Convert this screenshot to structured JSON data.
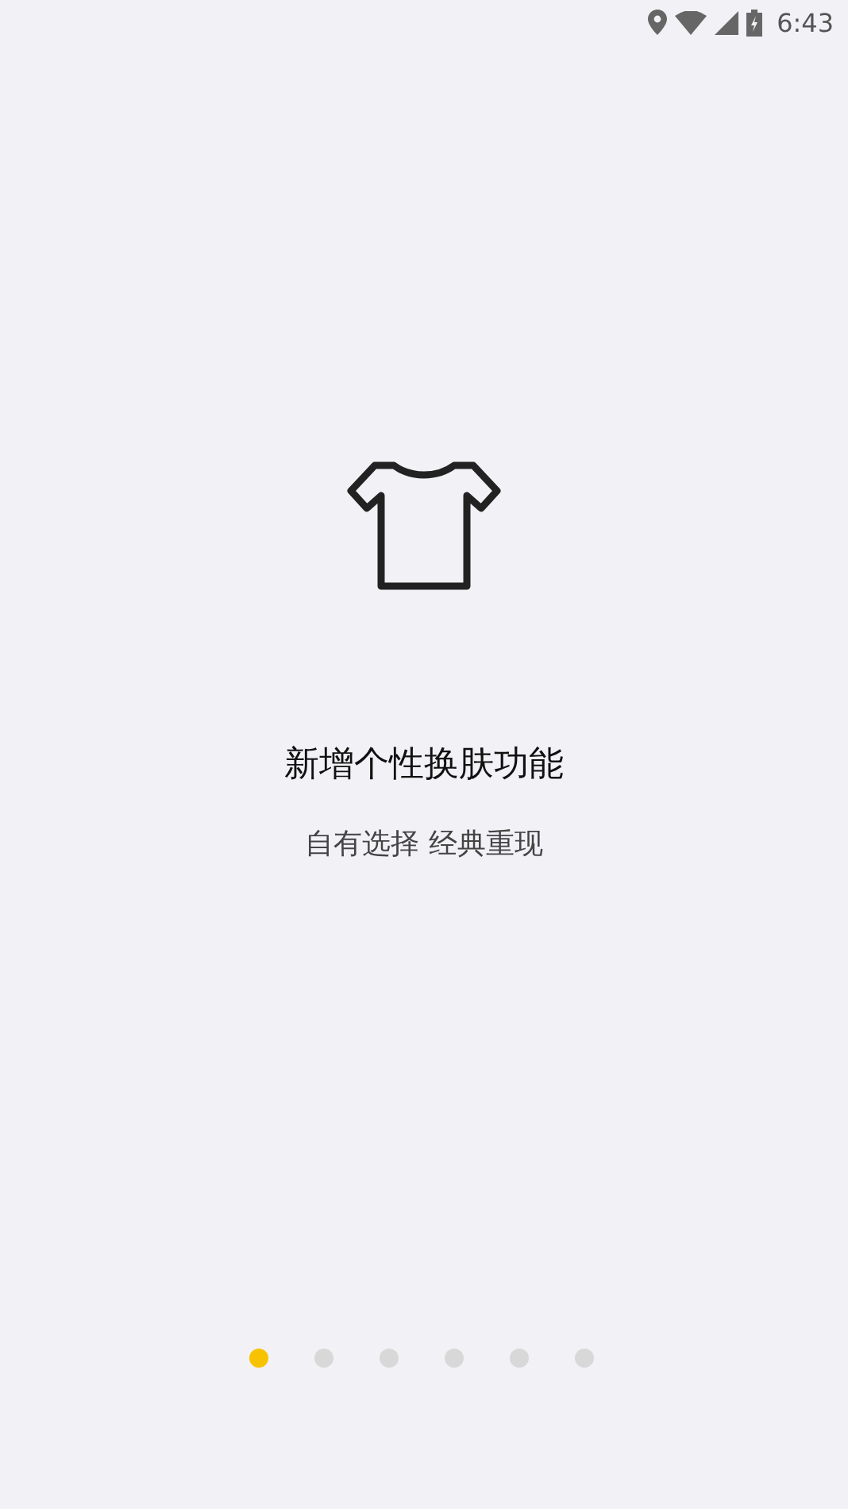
{
  "status_bar": {
    "time": "6:43"
  },
  "onboarding": {
    "title": "新增个性换肤功能",
    "subtitle": "自有选择 经典重现"
  },
  "pages": [
    {
      "selected": true
    },
    {
      "selected": false
    },
    {
      "selected": false
    },
    {
      "selected": false
    },
    {
      "selected": false
    },
    {
      "selected": false
    }
  ]
}
